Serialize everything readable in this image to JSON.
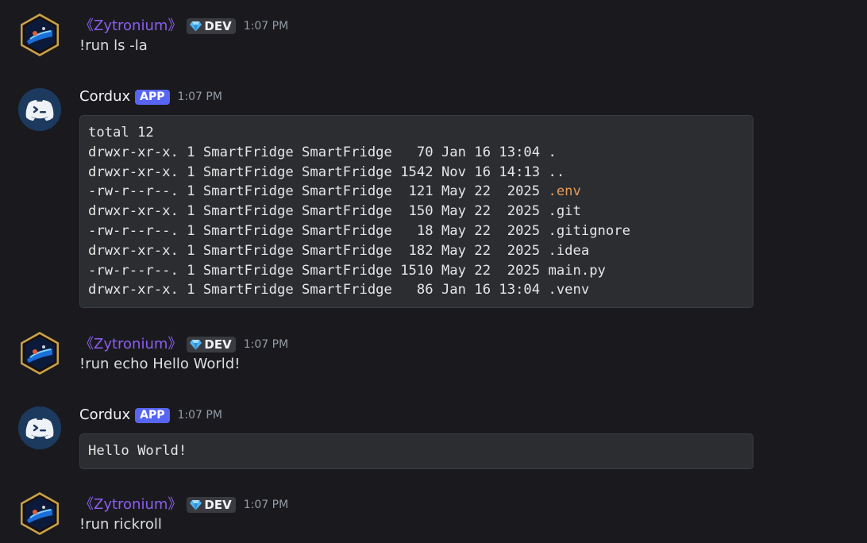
{
  "colors": {
    "background": "#1a1a1e",
    "username_user": "#8c5ef0",
    "username_bot": "#f2f3f5",
    "app_badge": "#5865f2",
    "codeblock_bg": "#2b2d31",
    "env_highlight": "#e79a59"
  },
  "messages": [
    {
      "author": "《Zytronium》",
      "badge": "DEV",
      "badge_icon": "gem-icon",
      "time": "1:07 PM",
      "text": "!run ls -la"
    },
    {
      "author": "Cordux",
      "badge": "APP",
      "time": "1:07 PM",
      "code": {
        "pre": [
          "total 12",
          "drwxr-xr-x. 1 SmartFridge SmartFridge   70 Jan 16 13:04 .",
          "drwxr-xr-x. 1 SmartFridge SmartFridge 1542 Nov 16 14:13 ..",
          "-rw-r--r--. 1 SmartFridge SmartFridge  121 May 22  2025 "
        ],
        "highlight": ".env",
        "post": [
          "drwxr-xr-x. 1 SmartFridge SmartFridge  150 May 22  2025 .git",
          "-rw-r--r--. 1 SmartFridge SmartFridge   18 May 22  2025 .gitignore",
          "drwxr-xr-x. 1 SmartFridge SmartFridge  182 May 22  2025 .idea",
          "-rw-r--r--. 1 SmartFridge SmartFridge 1510 May 22  2025 main.py",
          "drwxr-xr-x. 1 SmartFridge SmartFridge   86 Jan 16 13:04 .venv"
        ]
      }
    },
    {
      "author": "《Zytronium》",
      "badge": "DEV",
      "badge_icon": "gem-icon",
      "time": "1:07 PM",
      "text": "!run echo Hello World!"
    },
    {
      "author": "Cordux",
      "badge": "APP",
      "time": "1:07 PM",
      "code_text": "Hello World!"
    },
    {
      "author": "《Zytronium》",
      "badge": "DEV",
      "badge_icon": "gem-icon",
      "time": "1:07 PM",
      "text": "!run rickroll"
    }
  ]
}
